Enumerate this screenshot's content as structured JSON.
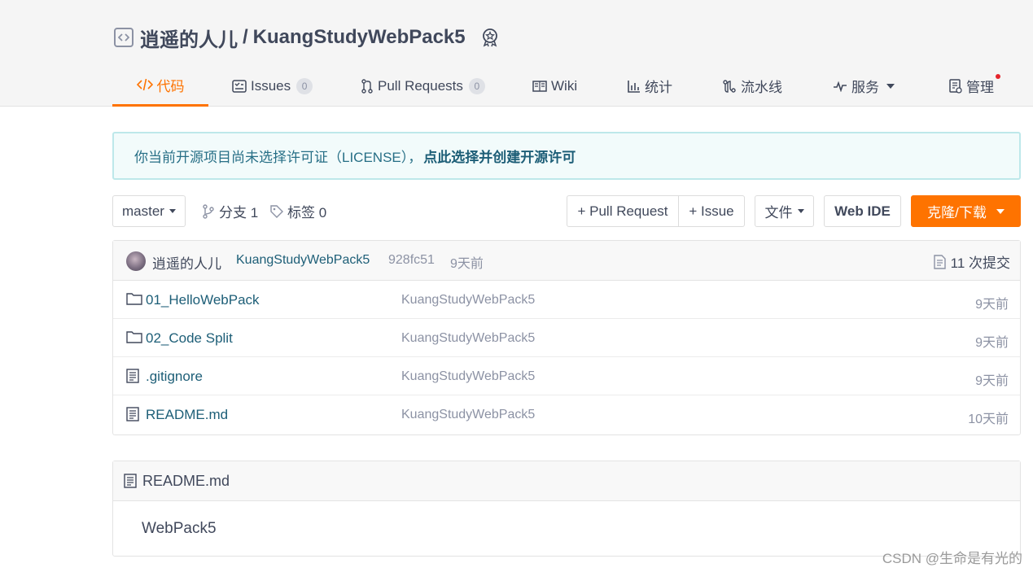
{
  "repo": {
    "owner": "逍遥的人儿",
    "separator": "/",
    "name": "KuangStudyWebPack5"
  },
  "tabs": [
    {
      "label": "代码",
      "active": true
    },
    {
      "label": "Issues",
      "count": "0"
    },
    {
      "label": "Pull Requests",
      "count": "0"
    },
    {
      "label": "Wiki"
    },
    {
      "label": "统计"
    },
    {
      "label": "流水线"
    },
    {
      "label": "服务"
    },
    {
      "label": "管理"
    }
  ],
  "notice": {
    "text": "你当前开源项目尚未选择许可证（LICENSE），",
    "link": "点此选择并创建开源许可"
  },
  "toolbar": {
    "branch": "master",
    "branches": "分支 1",
    "tags": "标签 0",
    "pull_request": "+ Pull Request",
    "issue": "+ Issue",
    "file": "文件",
    "web_ide": "Web IDE",
    "clone": "克隆/下载"
  },
  "latest_commit": {
    "author": "逍遥的人儿",
    "message": "KuangStudyWebPack5",
    "hash": "928fc51",
    "time": "9天前",
    "total_commits": "11 次提交"
  },
  "files": [
    {
      "name": "01_HelloWebPack",
      "type": "folder",
      "message": "KuangStudyWebPack5",
      "time": "9天前"
    },
    {
      "name": "02_Code Split",
      "type": "folder",
      "message": "KuangStudyWebPack5",
      "time": "9天前"
    },
    {
      "name": ".gitignore",
      "type": "file",
      "message": "KuangStudyWebPack5",
      "time": "9天前"
    },
    {
      "name": "README.md",
      "type": "file",
      "message": "KuangStudyWebPack5",
      "time": "10天前"
    }
  ],
  "readme": {
    "title": "README.md",
    "content": "WebPack5"
  },
  "watermark": "CSDN @生命是有光的",
  "colors": {
    "accent": "#fe7300",
    "link": "#1d5e77",
    "notice_border": "#bde8ea",
    "notice_bg": "#f2fbfb",
    "muted": "#8c92a4"
  }
}
